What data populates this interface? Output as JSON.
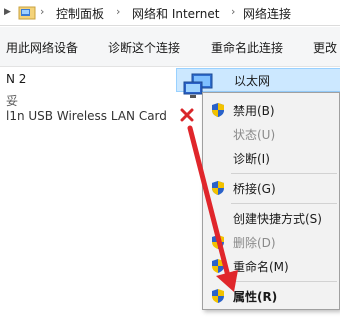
{
  "address_bar": {
    "crumbs": [
      "控制面板",
      "网络和 Internet",
      "网络连接"
    ],
    "separator": "›",
    "nav_arrow": "▶"
  },
  "toolbar": {
    "buttons": [
      "用此网络设备",
      "诊断这个连接",
      "重命名此连接",
      "更改"
    ]
  },
  "connections": {
    "left": {
      "name": "N 2",
      "status": "妥",
      "device": "l1n USB Wireless LAN Card"
    },
    "selected": {
      "name": "以太网"
    }
  },
  "context_menu": {
    "items": [
      {
        "label": "禁用(B)",
        "shield": true,
        "disabled": false,
        "bold": false
      },
      {
        "label": "状态(U)",
        "shield": false,
        "disabled": true,
        "bold": false
      },
      {
        "label": "诊断(I)",
        "shield": false,
        "disabled": false,
        "bold": false
      },
      {
        "label": "桥接(G)",
        "shield": true,
        "disabled": false,
        "bold": false
      },
      {
        "label": "创建快捷方式(S)",
        "shield": false,
        "disabled": false,
        "bold": false
      },
      {
        "label": "删除(D)",
        "shield": true,
        "disabled": true,
        "bold": false
      },
      {
        "label": "重命名(M)",
        "shield": true,
        "disabled": false,
        "bold": false
      },
      {
        "label": "属性(R)",
        "shield": true,
        "disabled": false,
        "bold": true
      }
    ]
  },
  "colors": {
    "selection": "#cce8ff",
    "arrow": "#e0262b",
    "shield_blue": "#2a62c9",
    "shield_yellow": "#f2c200"
  }
}
